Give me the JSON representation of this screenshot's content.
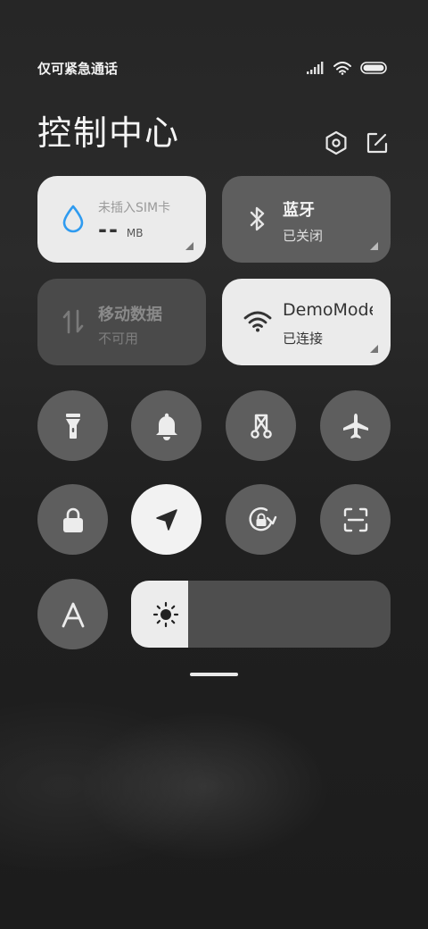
{
  "status_bar": {
    "carrier_text": "仅可紧急通话"
  },
  "header": {
    "title": "控制中心"
  },
  "tiles": {
    "data_usage": {
      "title": "未插入SIM卡",
      "value": "--",
      "unit": "MB"
    },
    "bluetooth": {
      "title": "蓝牙",
      "status": "已关闭"
    },
    "mobile_data": {
      "title": "移动数据",
      "status": "不可用"
    },
    "wifi": {
      "title": "DemoMode",
      "status": "已连接"
    }
  },
  "toggles": [
    {
      "name": "flashlight",
      "icon": "flashlight-icon",
      "active": false
    },
    {
      "name": "silent",
      "icon": "bell-icon",
      "active": false
    },
    {
      "name": "screenshot",
      "icon": "scissors-icon",
      "active": false
    },
    {
      "name": "airplane",
      "icon": "airplane-icon",
      "active": false
    },
    {
      "name": "lock",
      "icon": "lock-icon",
      "active": false
    },
    {
      "name": "location",
      "icon": "location-arrow-icon",
      "active": true
    },
    {
      "name": "rotation-lock",
      "icon": "rotation-lock-icon",
      "active": false
    },
    {
      "name": "scanner",
      "icon": "scan-icon",
      "active": false
    },
    {
      "name": "font",
      "icon": "font-a-icon",
      "active": false
    }
  ],
  "brightness": {
    "level": 0.22
  },
  "colors": {
    "accent_blue": "#2f9bf0",
    "tile_light": "#ebebeb",
    "tile_dark": "#5e5e5e"
  }
}
